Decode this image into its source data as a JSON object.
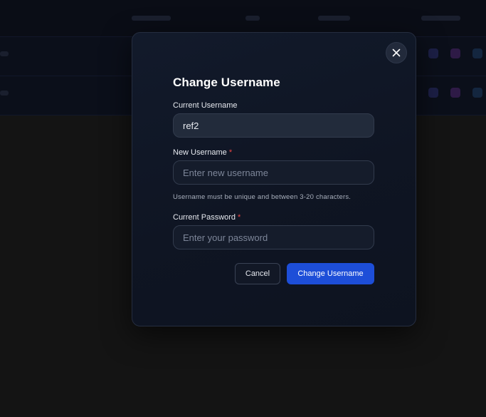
{
  "modal": {
    "title": "Change Username",
    "current_username": {
      "label": "Current Username",
      "value": "ref2"
    },
    "new_username": {
      "label": "New Username",
      "required_marker": "*",
      "placeholder": "Enter new username",
      "hint": "Username must be unique and between 3-20 characters."
    },
    "current_password": {
      "label": "Current Password",
      "required_marker": "*",
      "placeholder": "Enter your password"
    },
    "buttons": {
      "cancel_label": "Cancel",
      "submit_label": "Change Username"
    },
    "close_icon": "close-icon"
  },
  "colors": {
    "primary": "#1d4ed8",
    "required": "#ef4444",
    "modal_bg": "#0f1523",
    "backdrop": "#141414"
  }
}
